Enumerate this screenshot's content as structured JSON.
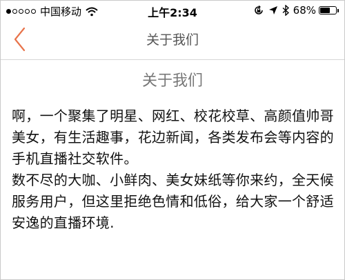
{
  "status_bar": {
    "carrier": "中国移动",
    "time": "上午2:34",
    "battery": "68%",
    "battery_level": 0.68,
    "signal_bars_filled": 1,
    "signal_bars_total": 5,
    "icons": [
      "wifi-icon",
      "lock-rotation-icon",
      "location-icon",
      "bluetooth-icon"
    ]
  },
  "nav": {
    "title": "关于我们",
    "back_icon": "chevron-left-icon",
    "accent_color": "#e8734a"
  },
  "content": {
    "title": "关于我们",
    "paragraph_1": "啊，一个聚集了明星、网红、校花校草、高颜值帅哥美女，有生活趣事，花边新闻，各类发布会等内容的手机直播社交软件。",
    "paragraph_2": "数不尽的大咖、小鲜肉、美女妹纸等你来约，全天候服务用户，但这里拒绝色情和低俗，给大家一个舒适安逸的直播环境."
  }
}
